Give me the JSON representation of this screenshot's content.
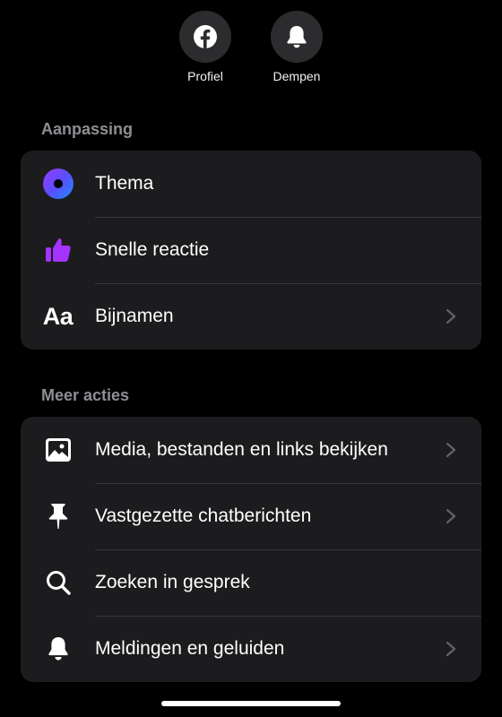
{
  "top_actions": [
    {
      "label": "Profiel",
      "icon": "facebook-icon"
    },
    {
      "label": "Dempen",
      "icon": "bell-icon"
    }
  ],
  "sections": {
    "customization": {
      "header": "Aanpassing",
      "items": [
        {
          "label": "Thema",
          "icon": "theme-circle-icon",
          "chevron": false,
          "icon_color": "#4f5cff"
        },
        {
          "label": "Snelle reactie",
          "icon": "thumbs-up-icon",
          "chevron": false,
          "icon_color": "#a533ff"
        },
        {
          "label": "Bijnamen",
          "icon": "text-aa-icon",
          "icon_text": "Aa",
          "chevron": true
        }
      ]
    },
    "more_actions": {
      "header": "Meer acties",
      "items": [
        {
          "label": "Media, bestanden en links bekijken",
          "icon": "image-icon",
          "chevron": true
        },
        {
          "label": "Vastgezette chatberichten",
          "icon": "pin-icon",
          "chevron": true
        },
        {
          "label": "Zoeken in gesprek",
          "icon": "search-icon",
          "chevron": false
        },
        {
          "label": "Meldingen en geluiden",
          "icon": "bell-icon",
          "chevron": true
        }
      ]
    }
  },
  "colors": {
    "background": "#000000",
    "card": "#1c1c1e",
    "secondary_text": "#8e8e93",
    "separator": "#38383a"
  }
}
